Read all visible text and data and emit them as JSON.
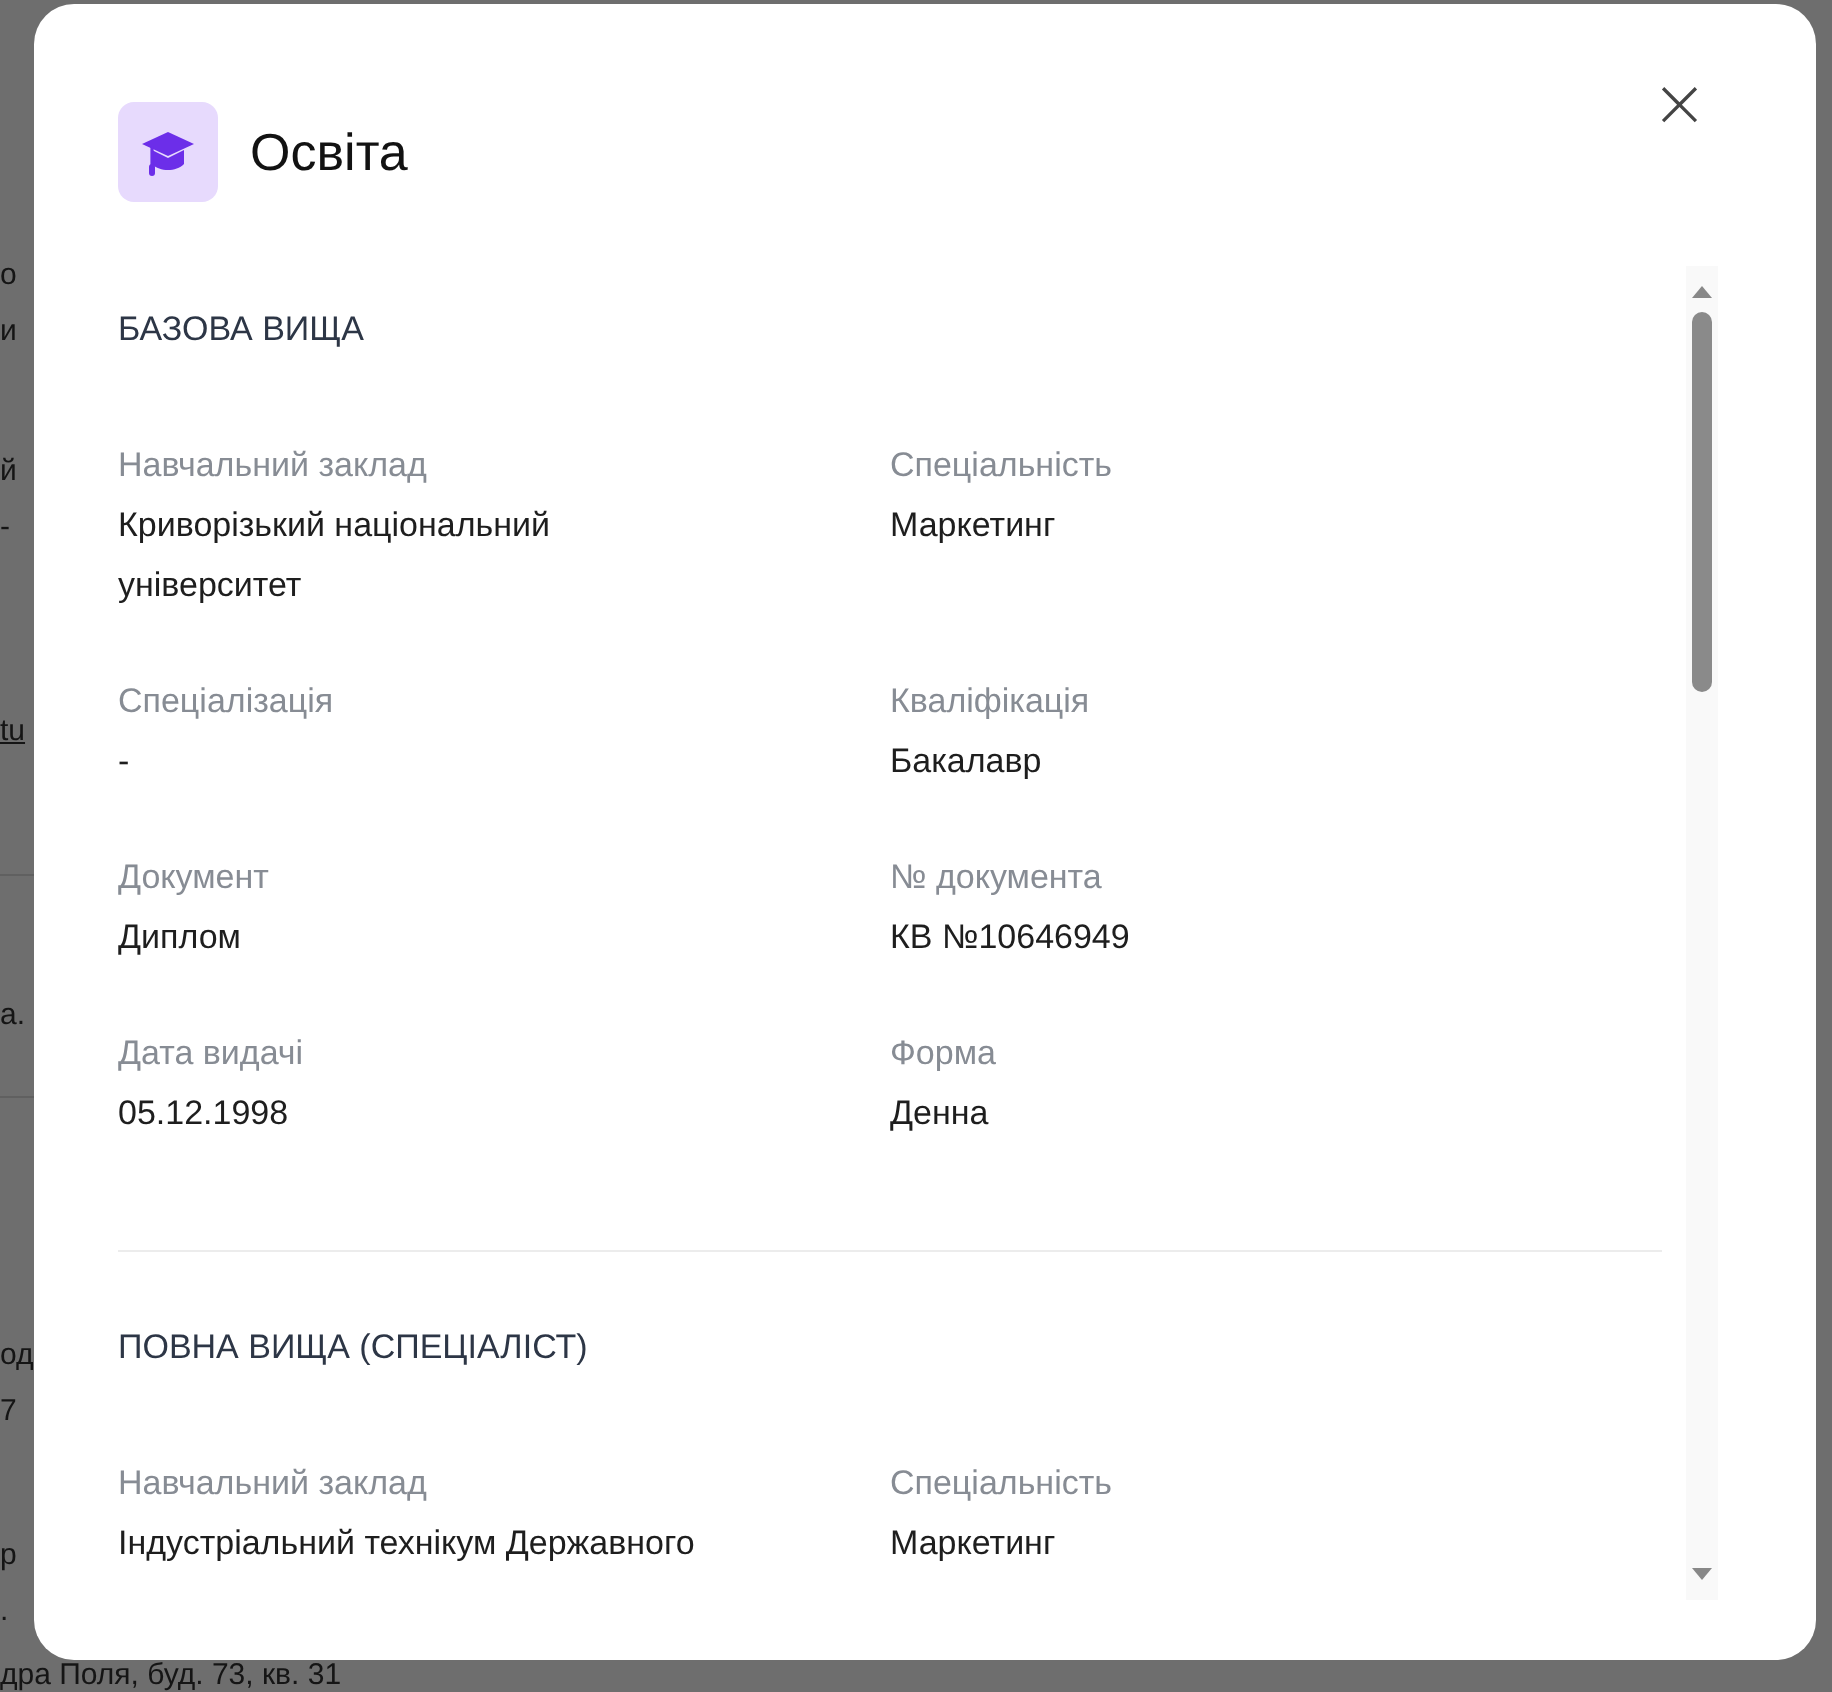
{
  "background_fragments": [
    "о",
    "и",
    "й",
    "-",
    "tu",
    "а.",
    "од",
    "7",
    "р",
    ".",
    "дра Поля, буд. 73, кв. 31"
  ],
  "dialog": {
    "title": "Освіта",
    "close": "×"
  },
  "sections": [
    {
      "heading": "БАЗОВА ВИЩА",
      "fields": [
        {
          "label": "Навчальний заклад",
          "value": "Криворізький національний університет"
        },
        {
          "label": "Спеціальність",
          "value": "Маркетинг"
        },
        {
          "label": "Спеціалізація",
          "value": "-"
        },
        {
          "label": "Кваліфікація",
          "value": "Бакалавр"
        },
        {
          "label": "Документ",
          "value": "Диплом"
        },
        {
          "label": "№ документа",
          "value": "КВ №10646949"
        },
        {
          "label": "Дата видачі",
          "value": "05.12.1998"
        },
        {
          "label": "Форма",
          "value": "Денна"
        }
      ]
    },
    {
      "heading": "ПОВНА ВИЩА (СПЕЦІАЛІСТ)",
      "fields": [
        {
          "label": "Навчальний заклад",
          "value": "Індустріальний технікум Державного"
        },
        {
          "label": "Спеціальність",
          "value": "Маркетинг"
        }
      ]
    }
  ]
}
